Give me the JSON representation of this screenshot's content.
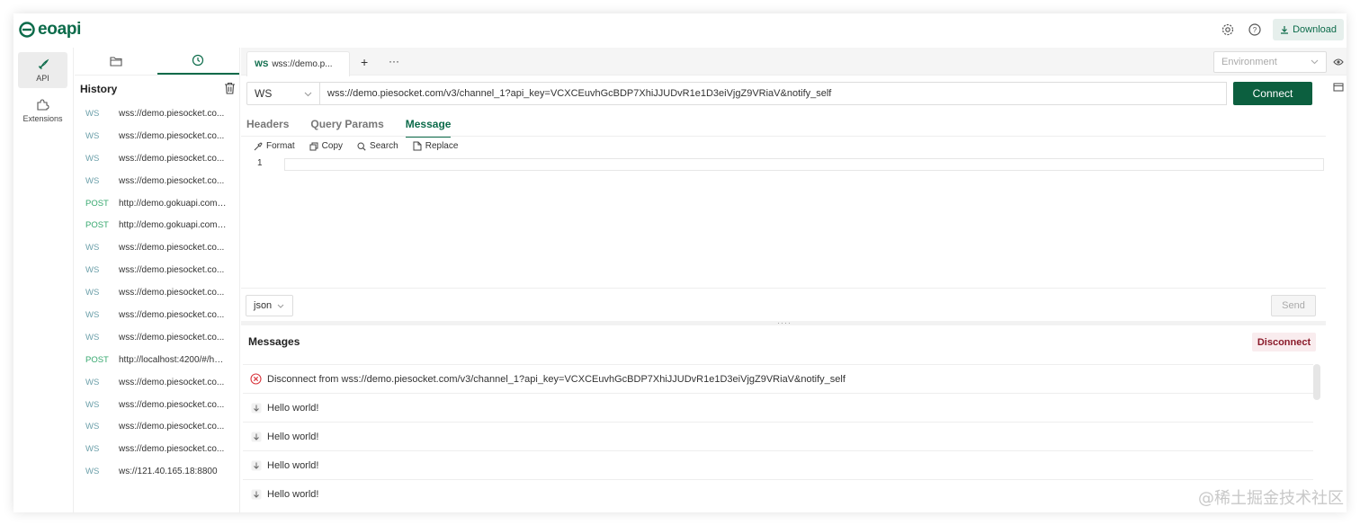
{
  "app": {
    "logo_text": "eoapi",
    "download_label": "Download",
    "watermark": "@稀土掘金技术社区"
  },
  "leftnav": {
    "items": [
      {
        "label": "API",
        "active": true
      },
      {
        "label": "Extensions",
        "active": false
      }
    ]
  },
  "history": {
    "title": "History",
    "items": [
      {
        "method": "WS",
        "url": "wss://demo.piesocket.co..."
      },
      {
        "method": "WS",
        "url": "wss://demo.piesocket.co..."
      },
      {
        "method": "WS",
        "url": "wss://demo.piesocket.co..."
      },
      {
        "method": "WS",
        "url": "wss://demo.piesocket.co..."
      },
      {
        "method": "POST",
        "url": "http://demo.gokuapi.com:..."
      },
      {
        "method": "POST",
        "url": "http://demo.gokuapi.com:..."
      },
      {
        "method": "WS",
        "url": "wss://demo.piesocket.co..."
      },
      {
        "method": "WS",
        "url": "wss://demo.piesocket.co..."
      },
      {
        "method": "WS",
        "url": "wss://demo.piesocket.co..."
      },
      {
        "method": "WS",
        "url": "wss://demo.piesocket.co..."
      },
      {
        "method": "WS",
        "url": "wss://demo.piesocket.co..."
      },
      {
        "method": "POST",
        "url": "http://localhost:4200/#/ho..."
      },
      {
        "method": "WS",
        "url": "wss://demo.piesocket.co..."
      },
      {
        "method": "WS",
        "url": "wss://demo.piesocket.co..."
      },
      {
        "method": "WS",
        "url": "wss://demo.piesocket.co..."
      },
      {
        "method": "WS",
        "url": "wss://demo.piesocket.co..."
      },
      {
        "method": "WS",
        "url": "ws://121.40.165.18:8800"
      }
    ]
  },
  "tabs": {
    "current": {
      "method": "WS",
      "title": "wss://demo.p..."
    },
    "add_label": "+",
    "more_label": "···"
  },
  "environment": {
    "placeholder": "Environment"
  },
  "request": {
    "protocol": "WS",
    "url": "wss://demo.piesocket.com/v3/channel_1?api_key=VCXCEuvhGcBDP7XhiJJUDvR1e1D3eiVjgZ9VRiaV&notify_self",
    "connect_label": "Connect"
  },
  "subtabs": [
    {
      "label": "Headers",
      "active": false
    },
    {
      "label": "Query Params",
      "active": false
    },
    {
      "label": "Message",
      "active": true
    }
  ],
  "editor": {
    "tools": [
      "Format",
      "Copy",
      "Search",
      "Replace"
    ],
    "line_number": "1",
    "format": "json",
    "send_label": "Send"
  },
  "messages": {
    "title": "Messages",
    "disconnect_label": "Disconnect",
    "items": [
      {
        "type": "error",
        "text": "Disconnect from wss://demo.piesocket.com/v3/channel_1?api_key=VCXCEuvhGcBDP7XhiJJUDvR1e1D3eiVjgZ9VRiaV&notify_self"
      },
      {
        "type": "received",
        "text": "Hello world!"
      },
      {
        "type": "received",
        "text": "Hello world!"
      },
      {
        "type": "received",
        "text": "Hello world!"
      },
      {
        "type": "received",
        "text": "Hello world!"
      }
    ]
  },
  "colors": {
    "brand": "#0c6b4a",
    "post": "#37a86f",
    "ws": "#6b9fa9",
    "error": "#d9363e"
  }
}
